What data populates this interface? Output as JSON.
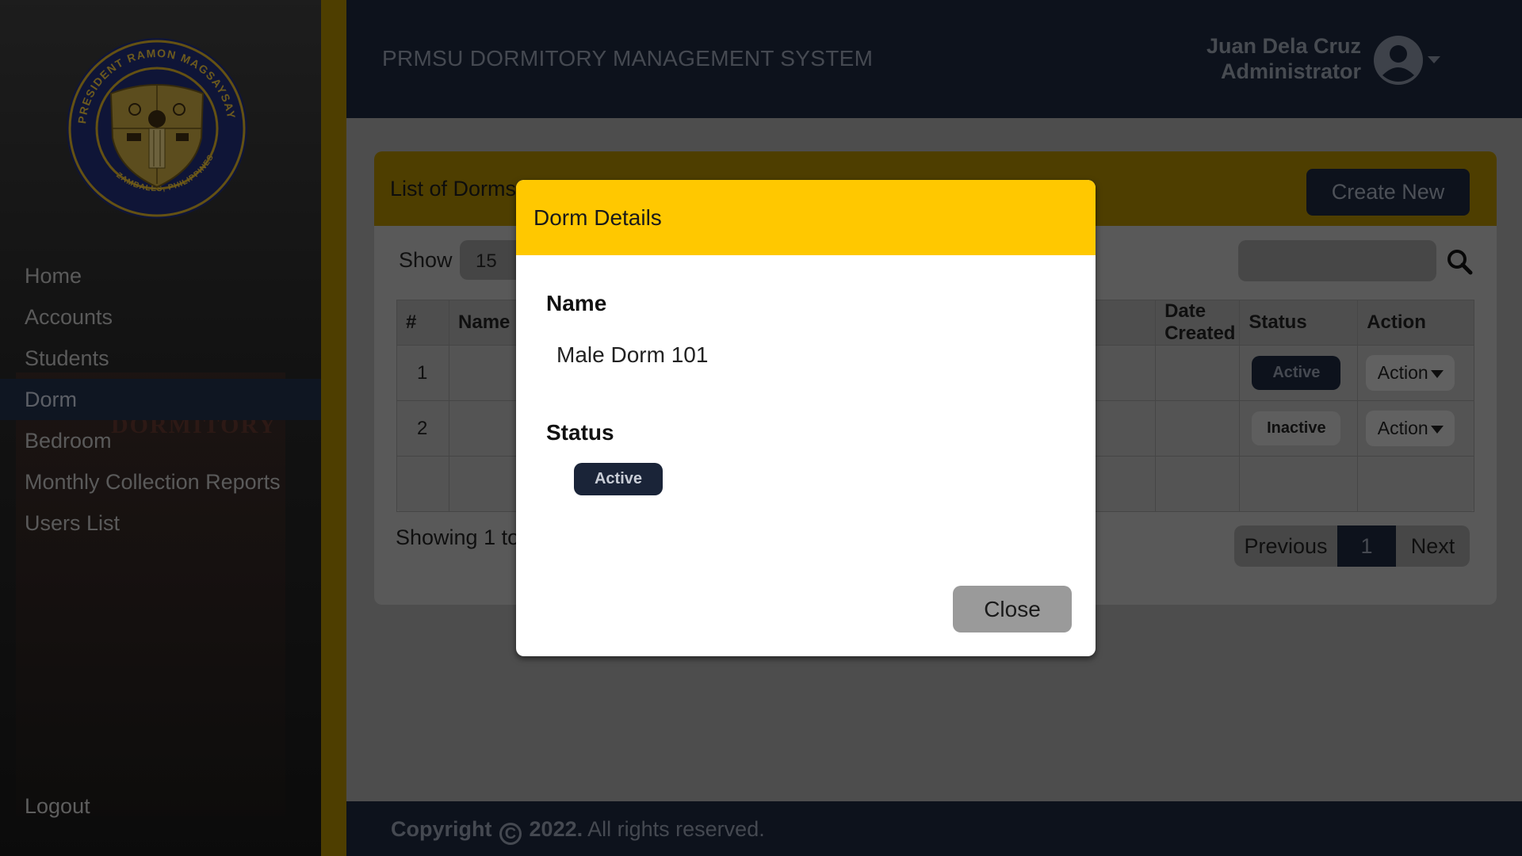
{
  "sidebar": {
    "logo": {
      "ring_text_top": "PRESIDENT RAMON MAGSAYSAY STATE UNIVERSITY",
      "ring_text_bottom": "ZAMBALES, PHILIPPINES"
    },
    "items": [
      {
        "label": "Home",
        "active": false
      },
      {
        "label": "Accounts",
        "active": false
      },
      {
        "label": "Students",
        "active": false
      },
      {
        "label": "Dorm",
        "active": true
      },
      {
        "label": "Bedroom",
        "active": false
      },
      {
        "label": "Monthly Collection Reports",
        "active": false
      },
      {
        "label": "Users List",
        "active": false
      }
    ],
    "logout_label": "Logout",
    "bg_sign": "DORMITORY"
  },
  "header": {
    "title": "PRMSU DORMITORY MANAGEMENT SYSTEM",
    "user_name": "Juan Dela Cruz",
    "user_role": "Administrator"
  },
  "card": {
    "title": "List of Dorms",
    "create_label": "Create New",
    "show_label": "Show",
    "show_value": "15",
    "columns": [
      "#",
      "Name",
      "Date Created",
      "Status",
      "Action"
    ],
    "rows": [
      {
        "num": "1",
        "status": "Active",
        "action": "Action"
      },
      {
        "num": "2",
        "status": "Inactive",
        "action": "Action"
      }
    ],
    "showing_text": "Showing 1 to",
    "pager": {
      "prev": "Previous",
      "page": "1",
      "next": "Next"
    }
  },
  "footer": {
    "copyright": "Copyright",
    "year": "2022.",
    "rights": "All rights reserved."
  },
  "modal": {
    "title": "Dorm Details",
    "name_label": "Name",
    "name_value": "Male Dorm 101",
    "status_label": "Status",
    "status_value": "Active",
    "close_label": "Close"
  },
  "colors": {
    "navy": "#1a2438",
    "gold": "#9c7c00",
    "modal_header": "#ffc800"
  }
}
